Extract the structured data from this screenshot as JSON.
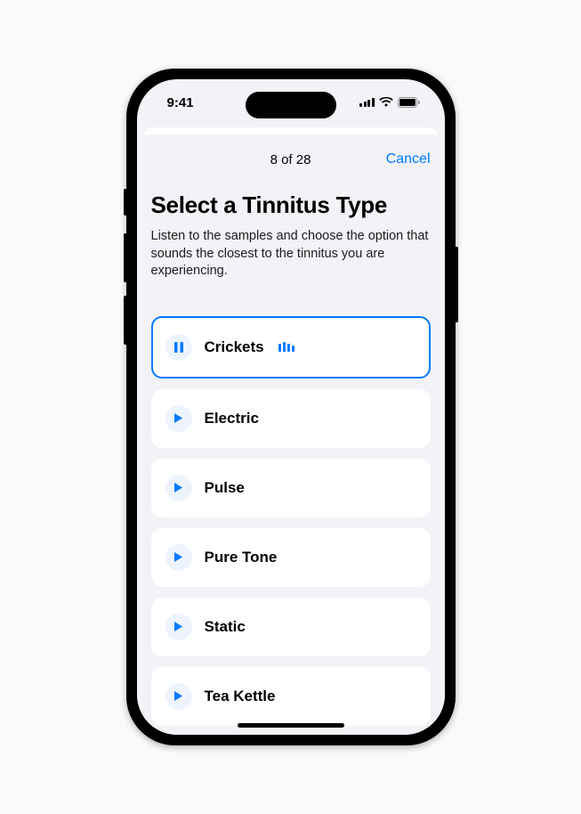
{
  "status": {
    "time": "9:41"
  },
  "header": {
    "progress": "8 of 28",
    "cancel": "Cancel"
  },
  "page": {
    "title": "Select a Tinnitus Type",
    "description": "Listen to the samples and choose the option that sounds the closest to the tinnitus you are experiencing."
  },
  "options": [
    {
      "label": "Crickets",
      "playing": true
    },
    {
      "label": "Electric",
      "playing": false
    },
    {
      "label": "Pulse",
      "playing": false
    },
    {
      "label": "Pure Tone",
      "playing": false
    },
    {
      "label": "Static",
      "playing": false
    },
    {
      "label": "Tea Kettle",
      "playing": false
    }
  ],
  "colors": {
    "accent": "#007aff"
  }
}
